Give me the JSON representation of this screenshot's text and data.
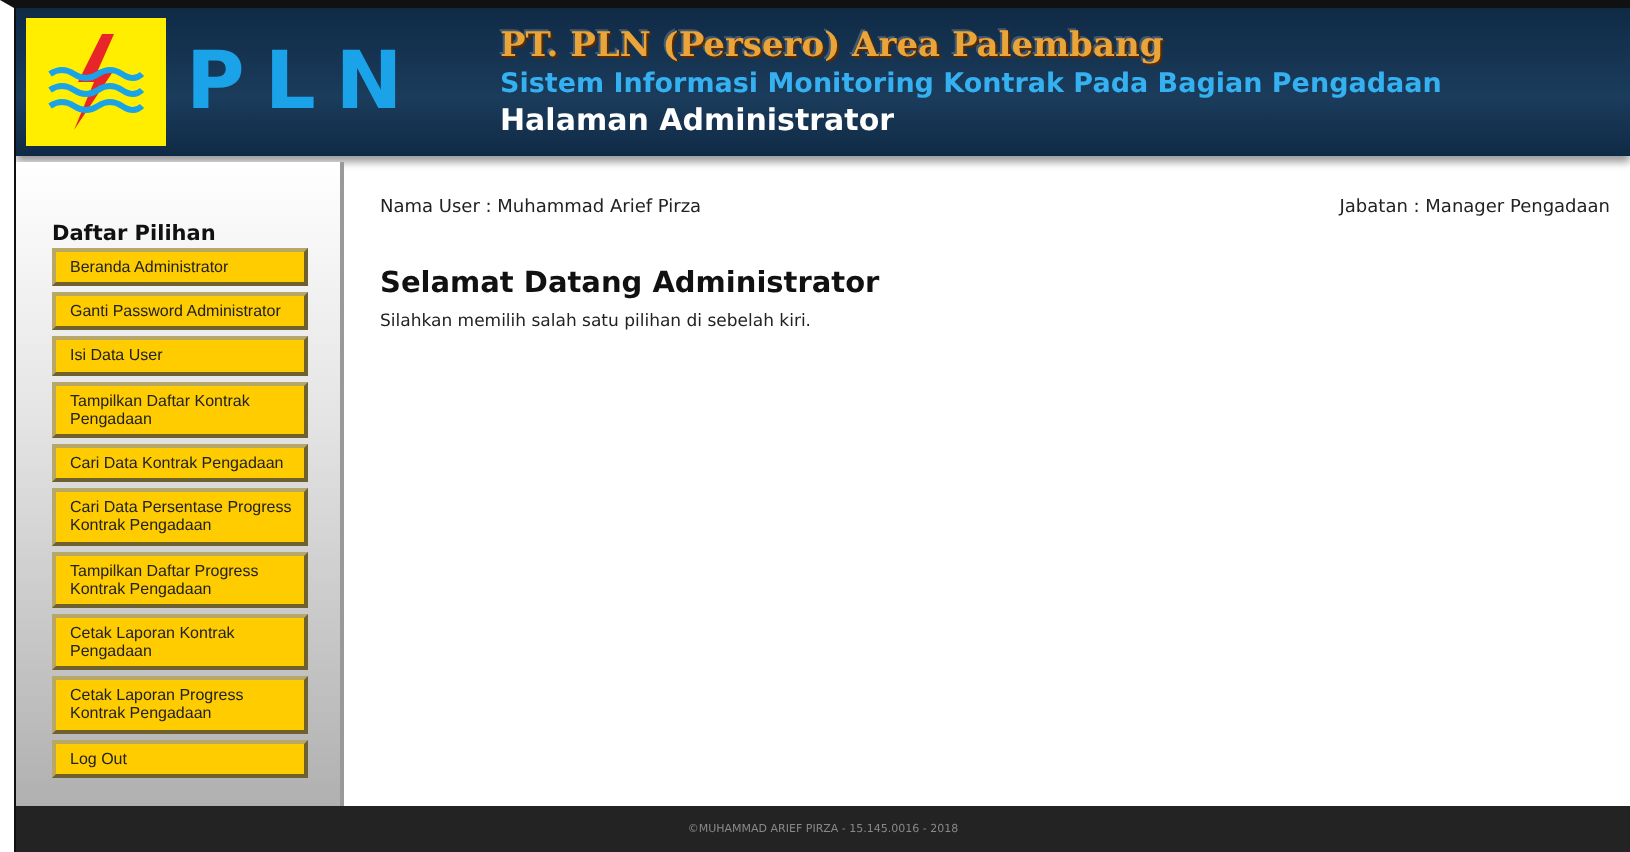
{
  "header": {
    "logo_text": "PLN",
    "title": "PT. PLN (Persero) Area Palembang",
    "subtitle": "Sistem Informasi Monitoring Kontrak Pada Bagian Pengadaan",
    "page": "Halaman Administrator"
  },
  "sidebar": {
    "heading": "Daftar Pilihan",
    "items": [
      {
        "label": "Beranda Administrator"
      },
      {
        "label": "Ganti Password Administrator"
      },
      {
        "label": "Isi Data User"
      },
      {
        "label": "Tampilkan Daftar Kontrak Pengadaan"
      },
      {
        "label": "Cari Data Kontrak Pengadaan"
      },
      {
        "label": "Cari Data Persentase Progress Kontrak Pengadaan"
      },
      {
        "label": "Tampilkan Daftar Progress Kontrak Pengadaan"
      },
      {
        "label": "Cetak Laporan Kontrak Pengadaan"
      },
      {
        "label": "Cetak Laporan Progress Kontrak Pengadaan"
      },
      {
        "label": "Log Out"
      }
    ]
  },
  "content": {
    "user": "Nama User : Muhammad Arief Pirza",
    "role": "Jabatan : Manager Pengadaan",
    "heading": "Selamat Datang Administrator",
    "message": "Silahkan memilih salah satu pilihan di sebelah kiri."
  },
  "footer": {
    "text": "©MUHAMMAD ARIEF PIRZA - 15.145.0016 - 2018"
  }
}
